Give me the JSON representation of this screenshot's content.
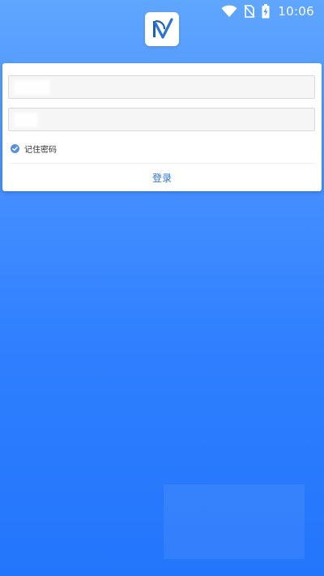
{
  "status_bar": {
    "time": "10:06",
    "icons": [
      "wifi-icon",
      "no-sim-icon",
      "battery-charging-icon"
    ]
  },
  "app": {
    "logo_icon": "app-logo-icon",
    "brand_color": "#2a74d6"
  },
  "login": {
    "username_placeholder": "",
    "password_placeholder": "",
    "remember_label": "记住密码",
    "remember_checked": true,
    "submit_label": "登录"
  },
  "colors": {
    "background_top": "#5fa6ff",
    "background_bottom": "#2375fb",
    "check_color": "#5a8fe0",
    "link_color": "#2a74d6"
  }
}
